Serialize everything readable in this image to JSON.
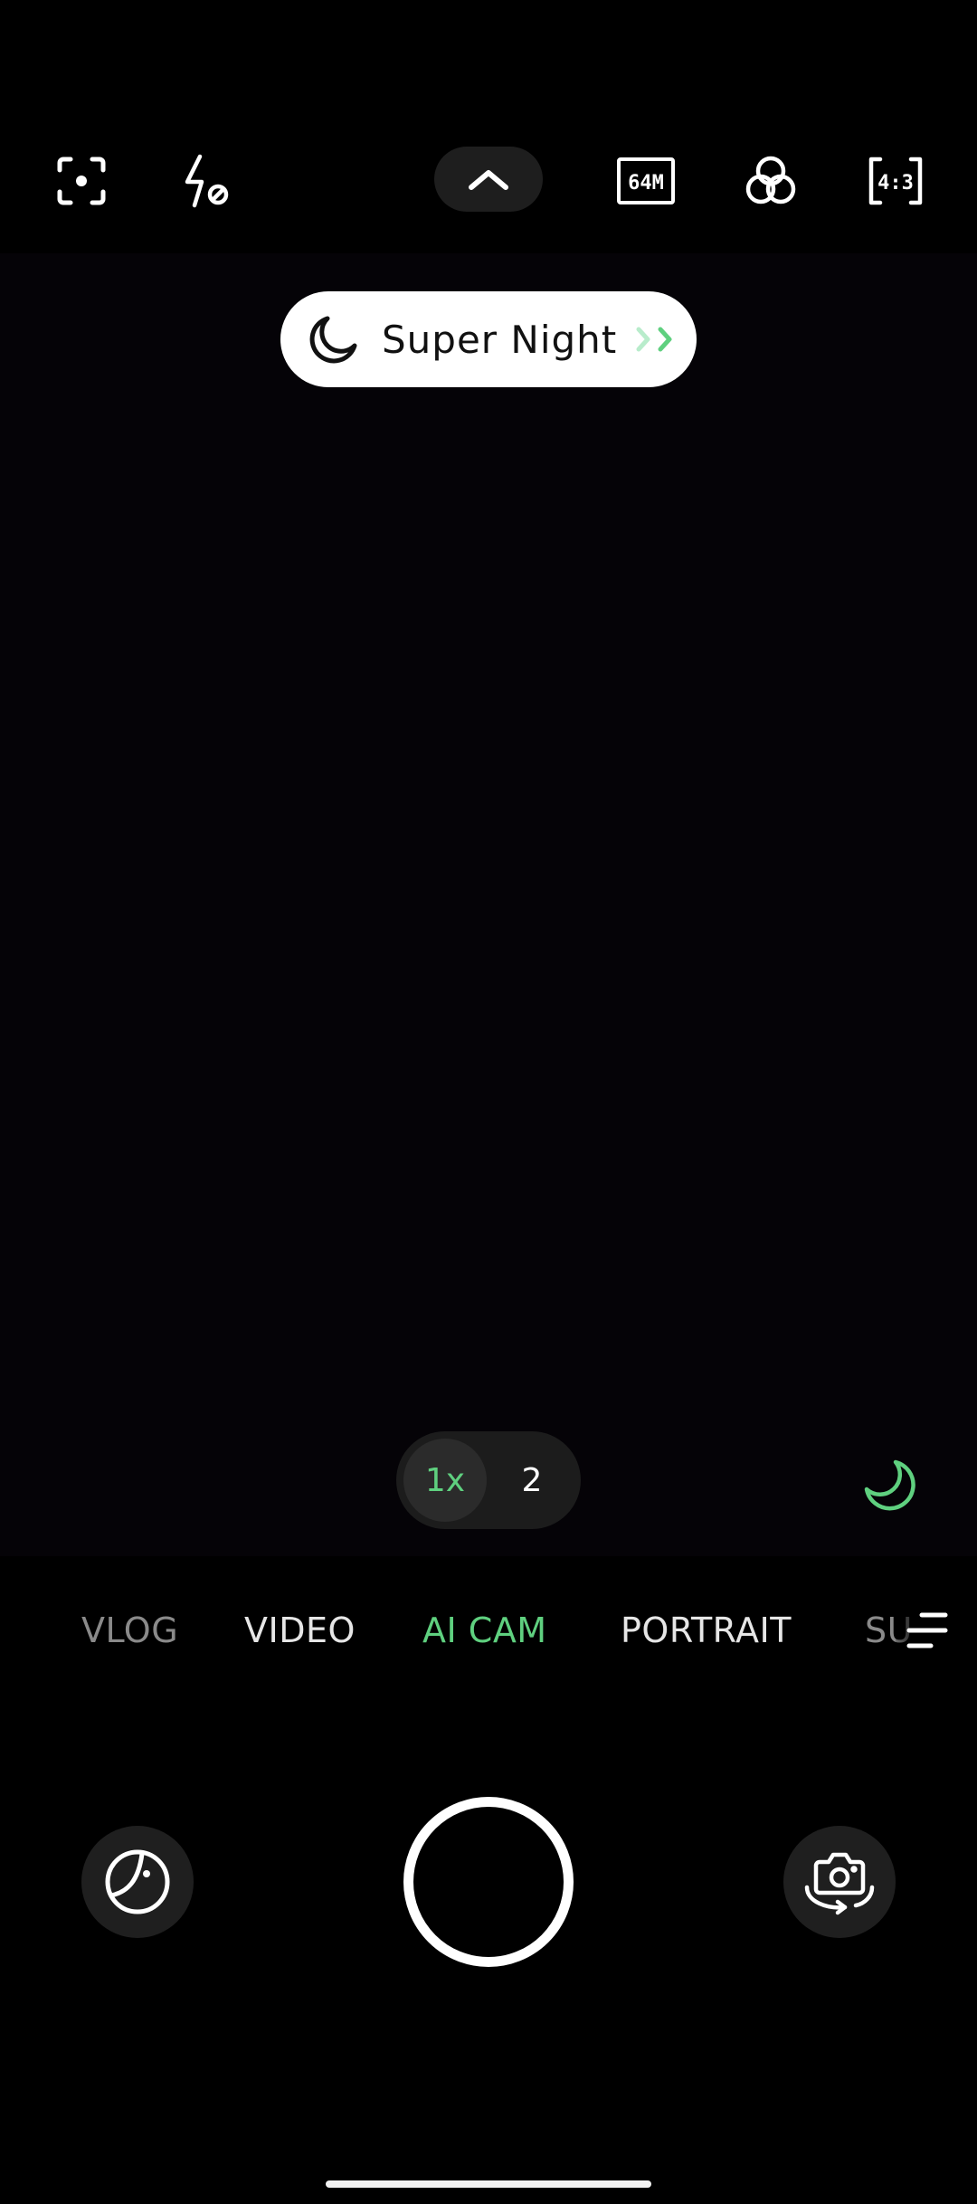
{
  "top_bar": {
    "icons": [
      "focus-icon",
      "flash-off-icon",
      "chevron-up-icon",
      "resolution-64m-icon",
      "filter-icon",
      "aspect-ratio-icon"
    ],
    "resolution_label": "64M",
    "aspect_ratio_label": "4:3"
  },
  "mode_pill": {
    "label": "Super Night",
    "icon": "moon-icon",
    "arrow_color": "#5fd07f"
  },
  "zoom": {
    "active": "1x",
    "other": "2"
  },
  "modes": {
    "items": [
      "VLOG",
      "VIDEO",
      "AI CAM",
      "PORTRAIT",
      "SU"
    ],
    "active": "AI CAM"
  },
  "colors": {
    "accent": "#5fd07f",
    "background": "#000000"
  },
  "bottom_bar": {
    "icons": [
      "gallery-icon",
      "shutter-button",
      "switch-camera-icon"
    ]
  }
}
